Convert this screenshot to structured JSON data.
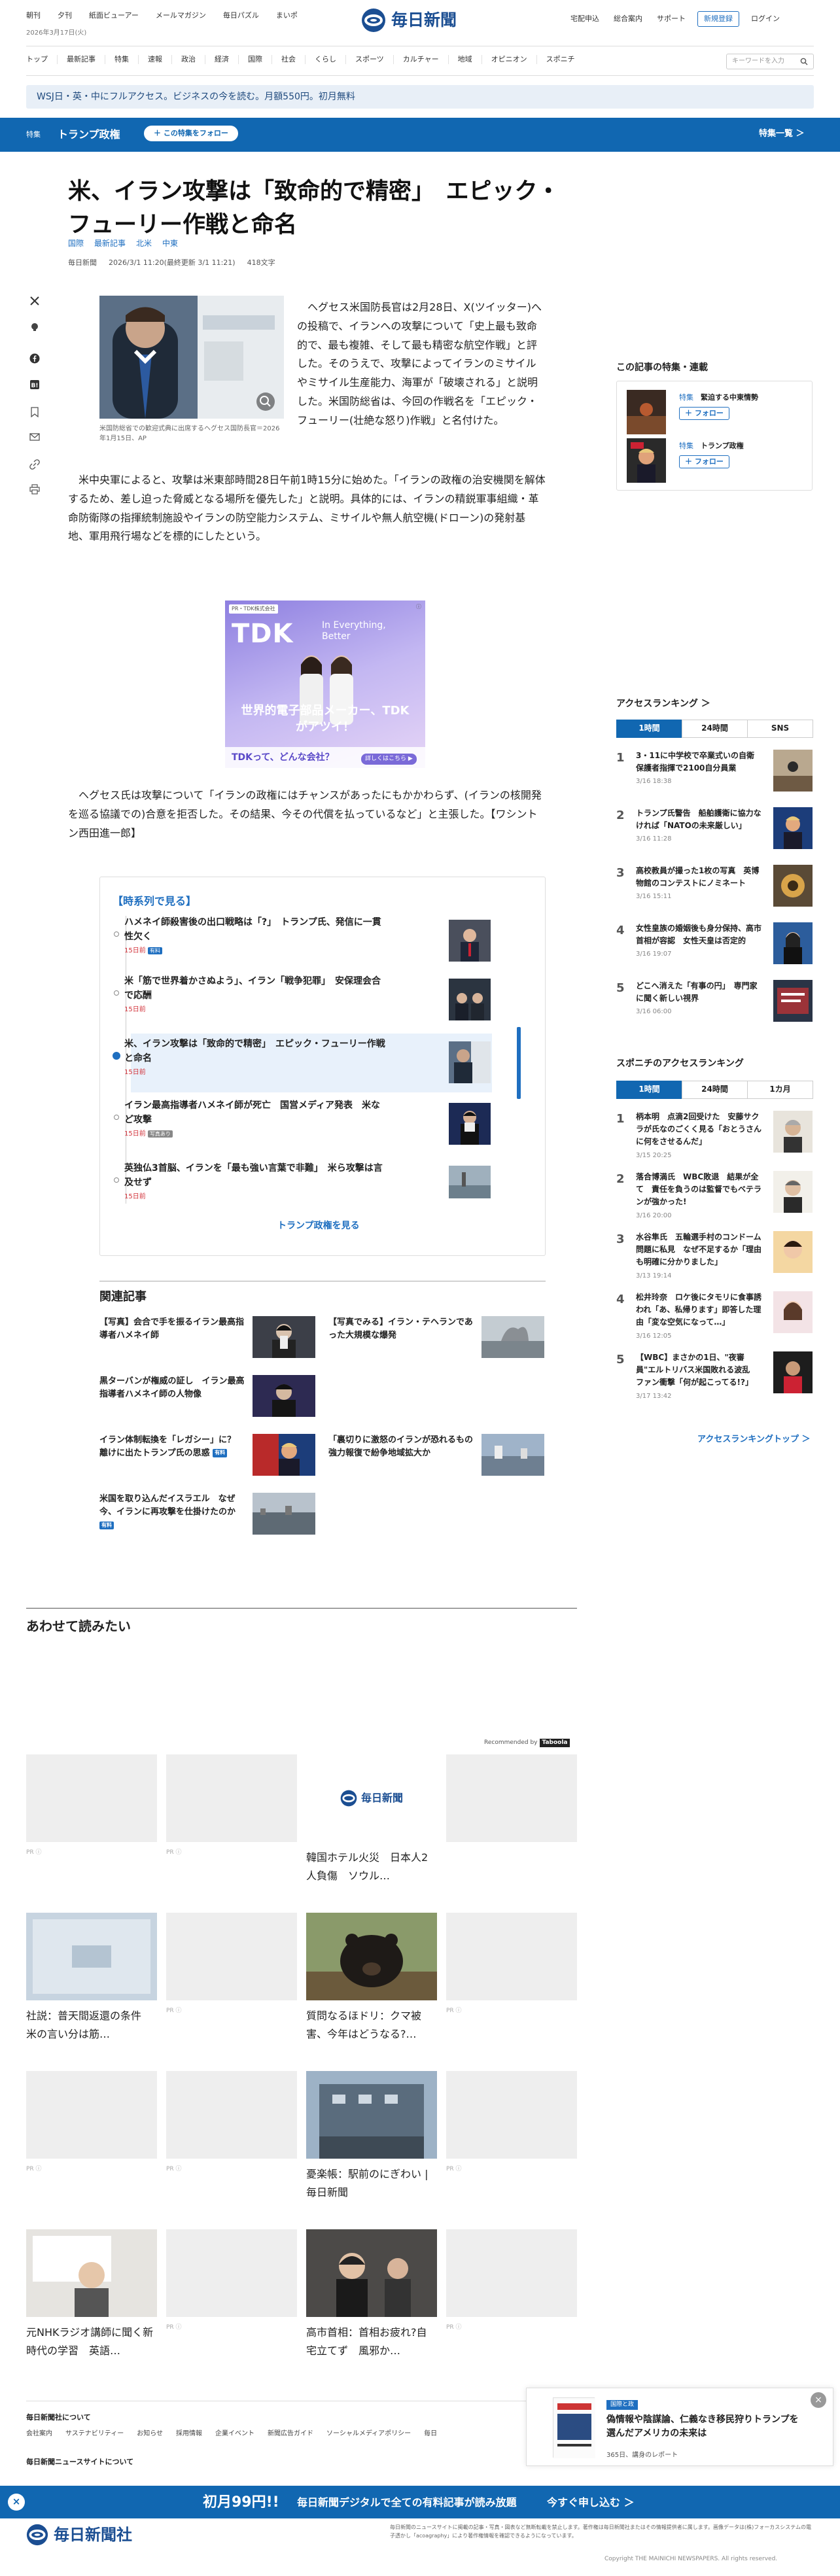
{
  "header": {
    "top_links": [
      "朝刊",
      "夕刊",
      "紙面ビューアー",
      "メールマガジン",
      "毎日パズル",
      "まいポ"
    ],
    "date": "2026年3月17日(火)",
    "logo_text": "毎日新聞",
    "right_links": [
      "宅配申込",
      "総合案内",
      "サポート"
    ],
    "register": "新規登録",
    "login": "ログイン",
    "nav": [
      "トップ",
      "最新記事",
      "特集",
      "速報",
      "政治",
      "経済",
      "国際",
      "社会",
      "くらし",
      "スポーツ",
      "カルチャー",
      "地域",
      "オピニオン",
      "スポニチ"
    ],
    "search_placeholder": "キーワードを入力"
  },
  "promo": {
    "text": "WSJ日・英・中にフルアクセス。ビジネスの今を読む。月額550円。初月無料"
  },
  "special": {
    "label": "特集",
    "title": "トランプ政権",
    "follow": "＋ この特集をフォロー",
    "list": "特集一覧 ＞"
  },
  "article": {
    "headline": "米、イラン攻撃は「致命的で精密」　エピック・フューリー作戦と命名",
    "tags": [
      "国際",
      "最新記事",
      "北米",
      "中東"
    ],
    "source": "毎日新聞",
    "date": "2026/3/1 11:20(最終更新 3/1 11:21)",
    "chars": "418文字",
    "caption": "米国防総省での歓迎式典に出席するヘグセス国防長官＝2026年1月15日、AP",
    "para1": "ヘグセス米国防長官は2月28日、X(ツイッター)への投稿で、イランへの攻撃について「史上最も致命的で、最も複雑、そして最も精密な航空作戦」と評した。そのうえで、攻撃によってイランのミサイルやミサイル生産能力、海軍が「破壊される」と説明した。米国防総省は、今回の作戦名を「エピック・フューリー(壮絶な怒り)作戦」と名付けた。",
    "para2": "米中央軍によると、攻撃は米東部時間28日午前1時15分に始めた。「イランの政権の治安機関を解体するため、差し迫った脅威となる場所を優先した」と説明。具体的には、イランの精鋭軍事組織・革命防衛隊の指揮統制施設やイランの防空能力システム、ミサイルや無人航空機(ドローン)の発射基地、軍用飛行場などを標的にしたという。",
    "para3": "ヘグセス氏は攻撃について「イランの政権にはチャンスがあったにもかかわらず、(イランの核開発を巡る協議での)合意を拒否した。その結果、今その代償を払っているなど」と主張した。【ワシントン西田進一郎】"
  },
  "ad": {
    "pr": "PR・TDK株式会社",
    "brand": "TDK",
    "tagline": "In Everything, Better",
    "headline": "世界的電子部品メーカー、TDKがアツイ！",
    "sub": "TDKって、どんな会社？",
    "more": "詳しくはこちら ▶"
  },
  "timeline": {
    "title": "【時系列で見る】",
    "items": [
      {
        "title": "ハメネイ師殺害後の出口戦略は「?」　トランプ氏、発信に一貫性欠く",
        "date": "15日前",
        "badge": "有料"
      },
      {
        "title": "米「筋で世界着かさぬよう」、イラン「戦争犯罪」　安保理会合で応酬",
        "date": "15日前",
        "badge": ""
      },
      {
        "title": "米、イラン攻撃は「致命的で精密」　エピック・フューリー作戦と命名",
        "date": "15日前",
        "badge": ""
      },
      {
        "title": "イラン最高指導者ハメネイ師が死亡　国営メディア発表　米など攻撃",
        "date": "15日前",
        "badge": "写真あり"
      },
      {
        "title": "英独仏3首脳、イランを「最も強い言葉で非難」　米ら攻撃は言及せず",
        "date": "15日前",
        "badge": ""
      }
    ],
    "more": "トランプ政権を見る"
  },
  "related": {
    "title": "関連記事",
    "items": [
      {
        "title": "【写真】会合で手を振るイラン最高指導者ハメネイ師",
        "badge": ""
      },
      {
        "title": "【写真でみる】イラン・テヘランであった大規模な爆発",
        "badge": ""
      },
      {
        "title": "黒ターバンが権威の証し　イラン最高指導者ハメネイ師の人物像",
        "badge": ""
      },
      {
        "title": "イラン体制転換を「レガシー」に？　離けに出たトランプ氏の思惑",
        "badge": "有料"
      },
      {
        "title": "「裏切りに激怒のイランが恐れるもの　強力報復で紛争地域拡大か",
        "badge": ""
      },
      {
        "title": "米国を取り込んだイスラエル　なぜ今、イランに再攻撃を仕掛けたのか",
        "badge": "有料"
      }
    ]
  },
  "readalso": {
    "title": "あわせて読みたい",
    "recommended": "Recommended by",
    "cards": [
      {
        "text": "",
        "pr": "PR ⓘ"
      },
      {
        "text": "",
        "pr": "PR ⓘ"
      },
      {
        "text": "韓国ホテル火災　日本人2人負傷　ソウル…",
        "pr": ""
      },
      {
        "text": "",
        "pr": ""
      },
      {
        "text": "社説：普天間返還の条件　米の言い分は筋…",
        "pr": ""
      },
      {
        "text": "",
        "pr": "PR ⓘ"
      },
      {
        "text": "質問なるほドリ：クマ被害、今年はどうなる?…",
        "pr": ""
      },
      {
        "text": "",
        "pr": "PR ⓘ"
      },
      {
        "text": "",
        "pr": "PR ⓘ"
      },
      {
        "text": "",
        "pr": "PR ⓘ"
      },
      {
        "text": "憂楽帳：駅前のにぎわい | 毎日新聞",
        "pr": ""
      },
      {
        "text": "",
        "pr": "PR ⓘ"
      },
      {
        "text": "元NHKラジオ講師に聞く新時代の学習　英語…",
        "pr": ""
      },
      {
        "text": "",
        "pr": "PR ⓘ"
      },
      {
        "text": "高市首相：首相お疲れ?自宅立てず　風邪か…",
        "pr": ""
      },
      {
        "text": "",
        "pr": "PR ⓘ"
      }
    ]
  },
  "sidebar": {
    "feature_title": "この記事の特集・連載",
    "features": [
      {
        "label": "特集",
        "name": "緊迫する中東情勢",
        "follow": "＋ フォロー"
      },
      {
        "label": "特集",
        "name": "トランプ政権",
        "follow": "＋ フォロー"
      }
    ],
    "ranking_title": "アクセスランキング ＞",
    "ranking_tabs": [
      "1時間",
      "24時間",
      "SNS"
    ],
    "ranking": [
      {
        "num": "1",
        "text": "3・11に中学校で卒業式いの自衛　保護者指揮で2100自分員業",
        "time": "3/16 18:38"
      },
      {
        "num": "2",
        "text": "トランプ氏警告　船舶護衛に協力なければ「NATOの未来厳しい」",
        "time": "3/16 11:28"
      },
      {
        "num": "3",
        "text": "高校教員が撮った1枚の写真　英博物館のコンテストにノミネート",
        "time": "3/16 15:11"
      },
      {
        "num": "4",
        "text": "女性皇族の婚姻後も身分保持、高市首相が容認　女性天皇は否定的",
        "time": "3/16 19:07"
      },
      {
        "num": "5",
        "text": "どこへ消えた「有事の円」　専門家に聞く新しい視界",
        "time": "3/16 06:00"
      }
    ],
    "sponichi_title": "スポニチのアクセスランキング",
    "sponichi_tabs": [
      "1時間",
      "24時間",
      "1カ月"
    ],
    "sponichi": [
      {
        "num": "1",
        "text": "柄本明　点滴2回受けた　安藤サクラが氏なのごくく見る「おとうさんに何をさせるんだ」",
        "time": "3/15 20:25"
      },
      {
        "num": "2",
        "text": "落合博満氏　WBC敗退　結果が全て　責任を負うのは監督でもベテランが強かった!",
        "time": "3/16 20:00"
      },
      {
        "num": "3",
        "text": "水谷隼氏　五輪選手村のコンドーム問題に私見　なぜ不足するか「理由も明確に分かりました」",
        "time": "3/13 19:14"
      },
      {
        "num": "4",
        "text": "松井玲奈　ロケ後にタモリに食事誘われ「あ、私帰ります」即答した理由「変な空気になって…」",
        "time": "3/16 12:05"
      },
      {
        "num": "5",
        "text": "【WBC】まさかの1日、\"夜審員\"エルトリバス米国敗れる波乱　ファン衝撃「何が起こってる!?」",
        "time": "3/17 13:42"
      }
    ],
    "ranking_more": "アクセスランキングトップ ＞"
  },
  "footer": {
    "about": "毎日新聞社について",
    "links": [
      "会社案内",
      "サステナビリティー",
      "お知らせ",
      "採用情報",
      "企業イベント",
      "新聞広告ガイド",
      "ソーシャルメディアポリシー",
      "毎日"
    ],
    "about2": "毎日新聞ニュースサイトについて",
    "logo": "毎日新聞社",
    "note": "毎日新聞のニュースサイトに掲載の記事・写真・図表など無断転載を禁止します。著作権は毎日新聞社またはその情報提供者に属します。画像データは(株)フォーカスシステムの電子透かし「acoagraphy」により著作権情報を確認できるようになっています。",
    "copyright": "Copyright THE MAINICHI NEWSPAPERS. All rights reserved."
  },
  "popup": {
    "tag": "国際と政",
    "title": "偽情報や陰謀論、仁義なき移民狩りトランプを選んだアメリカの未来は",
    "date": "365日、講身のレポート"
  },
  "bottom": {
    "price": "初月99円!!",
    "text": "毎日新聞デジタルで全ての有料記事が読み放題",
    "apply": "今すぐ申し込む ＞"
  },
  "colors": {
    "brand": "#1167b1",
    "accent": "#1f6fc0",
    "date_red": "#d2323a"
  }
}
